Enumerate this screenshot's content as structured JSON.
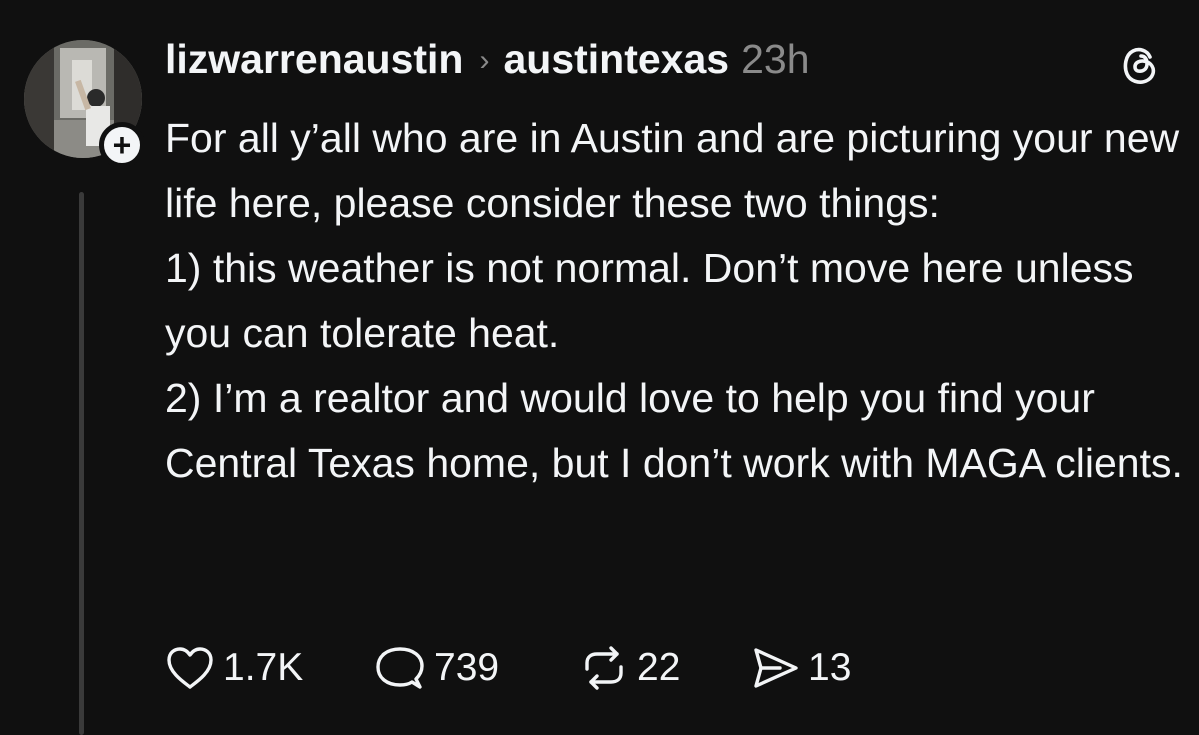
{
  "post": {
    "username": "lizwarrenaustin",
    "separator_icon": "chevron-right-icon",
    "community": "austintexas",
    "timestamp": "23h",
    "logo_icon": "threads-logo-icon",
    "follow_badge": "+",
    "text_lines": [
      "For all y’all who are in Austin and are picturing your new life here, please consider these two things:",
      "1) this weather is not normal. Don’t move here unless you can tolerate heat.",
      "2) I’m a realtor and would love to help you find your Central Texas home, but I don’t work with MAGA clients."
    ]
  },
  "actions": {
    "likes": {
      "icon": "heart-icon",
      "count": "1.7K"
    },
    "replies": {
      "icon": "comment-icon",
      "count": "739"
    },
    "reposts": {
      "icon": "repost-icon",
      "count": "22"
    },
    "shares": {
      "icon": "send-icon",
      "count": "13"
    }
  },
  "colors": {
    "background": "#101010",
    "primary_text": "#f3f5f7",
    "secondary_text": "#8a8a8a",
    "thread_line": "#3a3a3a"
  }
}
